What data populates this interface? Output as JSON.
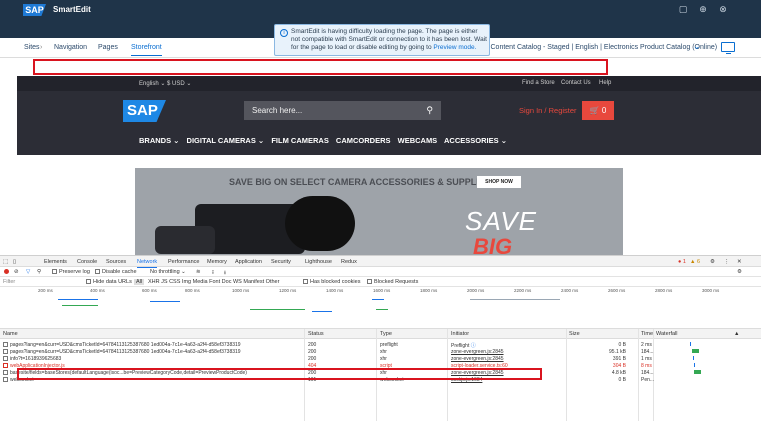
{
  "colors": {
    "sap_blue": "#1e88e5",
    "header_dark": "#1f3449",
    "accent_red": "#e8483d",
    "devtools_blue": "#1a73e8",
    "error_red": "#d93025"
  },
  "smartedit": {
    "brand_logo": "SAP",
    "brand": "SmartEdit",
    "nav": {
      "sites": "Sites",
      "navigation": "Navigation",
      "pages": "Pages",
      "storefront": "Storefront"
    },
    "catalog": "ics Content Catalog - Staged | English | Electronics Product Catalog (Online)",
    "toast": {
      "text": "SmartEdit is having difficulty loading the page. The page is either not compatible with SmartEdit or connection to it has been lost. Wait for the page to load or disable editing by going to",
      "link": "Preview mode."
    }
  },
  "storefront": {
    "utility": {
      "lang": "English ⌄  $ USD ⌄",
      "find_store": "Find a Store",
      "contact": "Contact Us",
      "help": "Help"
    },
    "logo": "SAP",
    "search_placeholder": "Search here...",
    "sign_in": "Sign In / Register",
    "cart_count": "0",
    "nav": [
      "BRANDS ⌄",
      "DIGITAL CAMERAS ⌄",
      "FILM CAMERAS",
      "CAMCORDERS",
      "WEBCAMS",
      "ACCESSORIES ⌄"
    ],
    "banner": {
      "headline": "SAVE BIG ON SELECT CAMERA ACCESSORIES & SUPPLIES",
      "button": "SHOP NOW",
      "save": "SAVE",
      "big": "BIG"
    }
  },
  "devtools": {
    "tabs": [
      "Elements",
      "Console",
      "Sources",
      "Network",
      "Performance",
      "Memory",
      "Application",
      "Security",
      "Lighthouse",
      "Redux"
    ],
    "badges": {
      "errors": "1",
      "warnings": "6"
    },
    "toolbar": {
      "preserve_log": "Preserve log",
      "disable_cache": "Disable cache",
      "throttling": "No throttling ⌄"
    },
    "filter": {
      "label": "Filter",
      "hide_data_urls": "Hide data URLs",
      "all": "All",
      "types": "XHR  JS  CSS  Img  Media  Font  Doc  WS  Manifest  Other",
      "blocked_cookies": "Has blocked cookies",
      "blocked_requests": "Blocked Requests"
    },
    "ticks": [
      "200 ms",
      "400 ms",
      "600 ms",
      "800 ms",
      "1000 ms",
      "1200 ms",
      "1400 ms",
      "1600 ms",
      "1800 ms",
      "2000 ms",
      "2200 ms",
      "2400 ms",
      "2600 ms",
      "2800 ms",
      "3000 ms"
    ],
    "columns": {
      "name": "Name",
      "status": "Status",
      "type": "Type",
      "initiator": "Initiator",
      "size": "Size",
      "time": "Time",
      "waterfall": "Waterfall"
    },
    "rows": [
      {
        "name": "pages?lang=en&curr=USD&cmsTicketId=64784113125387680 1ed004a-7c1e-4a63-a2f4-d58ef3738319",
        "status": "200",
        "type": "preflight",
        "initiator": "Preflight",
        "size": "0 B",
        "time": "2 ms"
      },
      {
        "name": "pages?lang=en&curr=USD&cmsTicketId=64784113125387680 1ed004a-7c1e-4a63-a2f4-d58ef3738319",
        "status": "200",
        "type": "xhr",
        "initiator": "zone-evergreen.js:2845",
        "size": "95.1 kB",
        "time": "184..."
      },
      {
        "name": "info?t=1618939625683",
        "status": "200",
        "type": "xhr",
        "initiator": "zone-evergreen.js:2845",
        "size": "391 B",
        "time": "1 ms"
      },
      {
        "name": "webApplicationInjector.js",
        "status": "404",
        "type": "script",
        "initiator": "script-loader.service.ts:60",
        "size": "304 B",
        "time": "8 ms",
        "error": true
      },
      {
        "name": "basesite/fields=baseStores(defaultLanguage(isoc...be=PreviewCategoryCode,detail=PreviewProductCode)",
        "status": "200",
        "type": "xhr",
        "initiator": "zone-evergreen.js:2845",
        "size": "4.8 kB",
        "time": "184..."
      },
      {
        "name": "websocket",
        "status": "101",
        "type": "websocket",
        "initiator": "sockjs.js:1684",
        "size": "0 B",
        "time": "Pen..."
      }
    ]
  }
}
